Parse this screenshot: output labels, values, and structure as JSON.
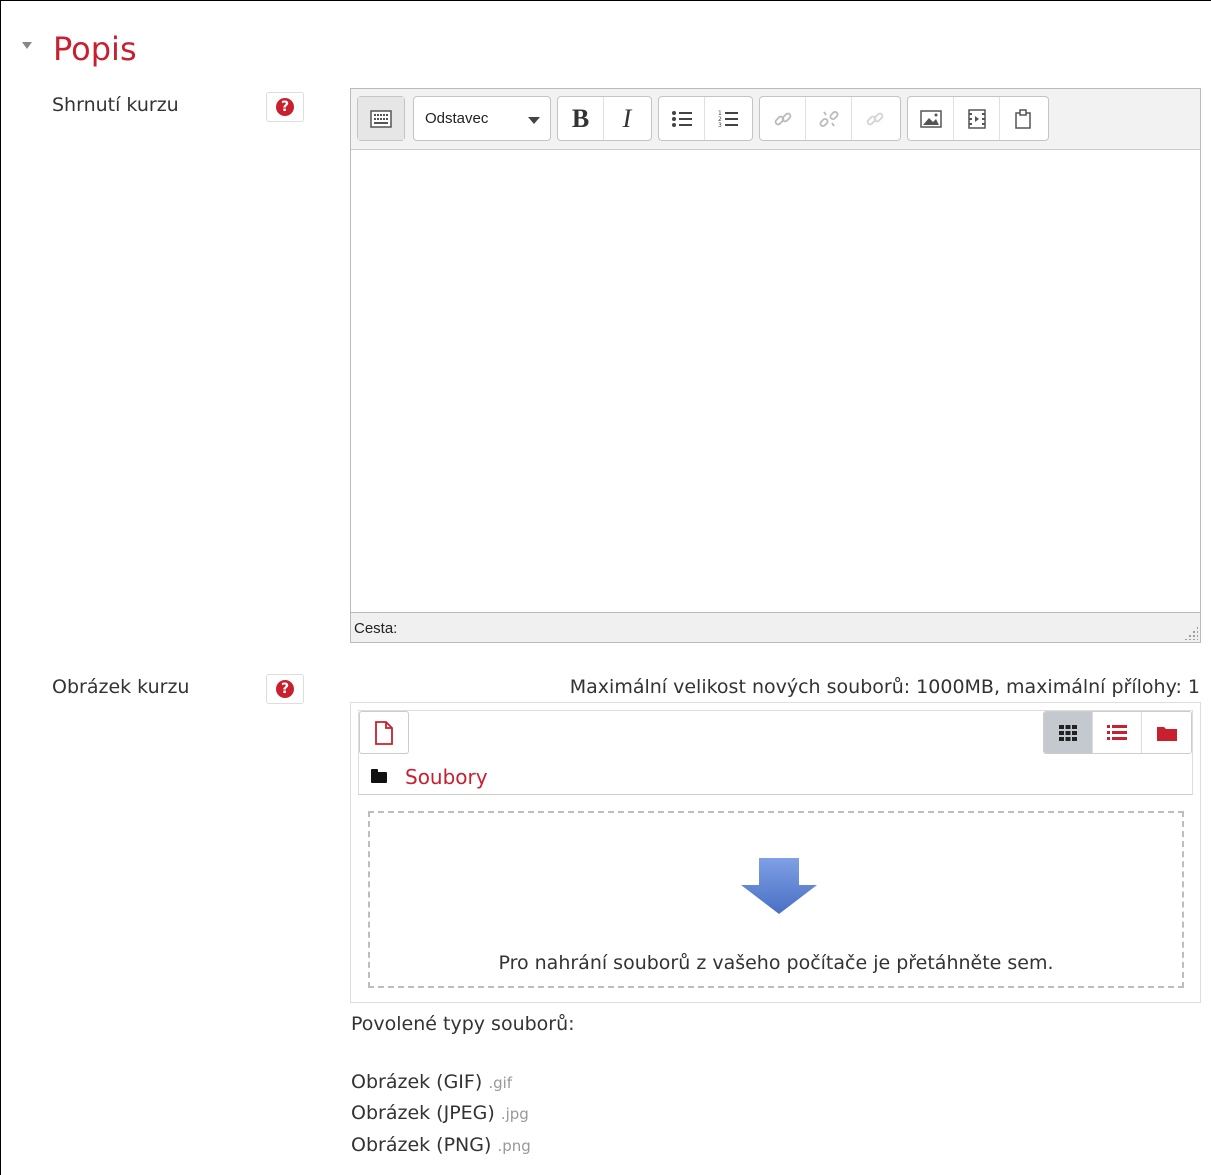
{
  "section": {
    "title": "Popis"
  },
  "summary_field": {
    "label": "Shrnutí kurzu",
    "help_icon": "question-circle-icon"
  },
  "editor": {
    "toolbar": {
      "toggle_icon": "keyboard-toolbar-toggle-icon",
      "format_select": "Odstavec",
      "bold_label": "B",
      "italic_label": "I",
      "icons": [
        "bullet-list-icon",
        "numbered-list-icon",
        "link-icon",
        "unlink-icon",
        "anchor-link-icon",
        "image-icon",
        "media-icon",
        "manage-files-icon"
      ]
    },
    "content": "",
    "status_label": "Cesta:"
  },
  "image_field": {
    "label": "Obrázek kurzu",
    "help_icon": "question-circle-icon",
    "max_info": "Maximální velikost nových souborů: 1000MB, maximální přílohy: 1",
    "path_label": "Soubory",
    "dropzone_text": "Pro nahrání souborů z vašeho počítače je přetáhněte sem.",
    "allowed_title": "Povolené typy souborů:",
    "allowed_types": [
      {
        "name": "Obrázek (GIF)",
        "ext": ".gif"
      },
      {
        "name": "Obrázek (JPEG)",
        "ext": ".jpg"
      },
      {
        "name": "Obrázek (PNG)",
        "ext": ".png"
      }
    ]
  },
  "colors": {
    "accent": "#c8202f",
    "dropzone_arrow": "#5b7fd0"
  }
}
